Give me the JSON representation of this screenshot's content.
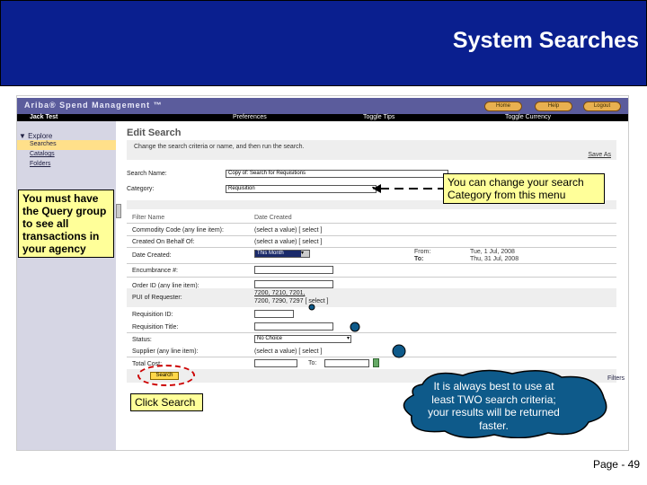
{
  "slide": {
    "title": "System Searches",
    "page": "Page - 49"
  },
  "app": {
    "brand": "Ariba® Spend Management ™",
    "buttons": [
      "Home",
      "Help",
      "Logout"
    ],
    "user": "Jack Test",
    "nav": [
      "Preferences",
      "Toggle Tips",
      "Toggle Currency"
    ]
  },
  "sidebar": {
    "section": "Explore",
    "items": [
      "Searches",
      "Catalogs",
      "Folders"
    ]
  },
  "main": {
    "title": "Edit Search",
    "instructions": "Change the search criteria or name, and then run the search.",
    "save_link": "Save As",
    "search_name_label": "Search Name:",
    "search_name_value": "Copy of: Search for Requisitions",
    "category_label": "Category:",
    "category_value": "Requisition",
    "filter_header": "Filter Name",
    "filter_header2": "Date Created",
    "filters": [
      {
        "label": "Commodity Code (any line item):",
        "value": "(select a value) [ select ]"
      },
      {
        "label": "Created On Behalf Of:",
        "value": "(select a value) [ select ]"
      },
      {
        "label": "Date Created:",
        "value": "This Month"
      },
      {
        "label": "Encumbrance #:",
        "value": ""
      },
      {
        "label": "Order ID (any line item):",
        "value": ""
      },
      {
        "label": "PUI of Requester:",
        "value": "7200, 7210, 7201,",
        "value2": "7200, 7290, 7297 [ select ]"
      },
      {
        "label": "Requisition ID:",
        "value": ""
      },
      {
        "label": "Requisition Title:",
        "value": ""
      },
      {
        "label": "Status:",
        "value": "No Choice"
      },
      {
        "label": "Supplier (any line item):",
        "value": "(select a value) [ select ]"
      },
      {
        "label": "Total Cost:",
        "value": "",
        "to": "To:"
      }
    ],
    "from_label": "From:",
    "from_value": "Tue, 1 Jul, 2008",
    "to_label": "To:",
    "to_value": "Thu, 31 Jul, 2008",
    "search_button": "Search",
    "filters_link": "Filters"
  },
  "callouts": {
    "query_group": "You must have the Query group to see all transactions in your agency",
    "category": "You can change your search Category from this menu",
    "click_search": "Click Search",
    "cloud": "It is always best to use at least TWO  search criteria; your results will be returned faster."
  },
  "colors": {
    "banner": "#0a1f8f",
    "note": "#ffff99",
    "cloud": "#0e5a8a",
    "highlight_circle": "#cc0000"
  }
}
